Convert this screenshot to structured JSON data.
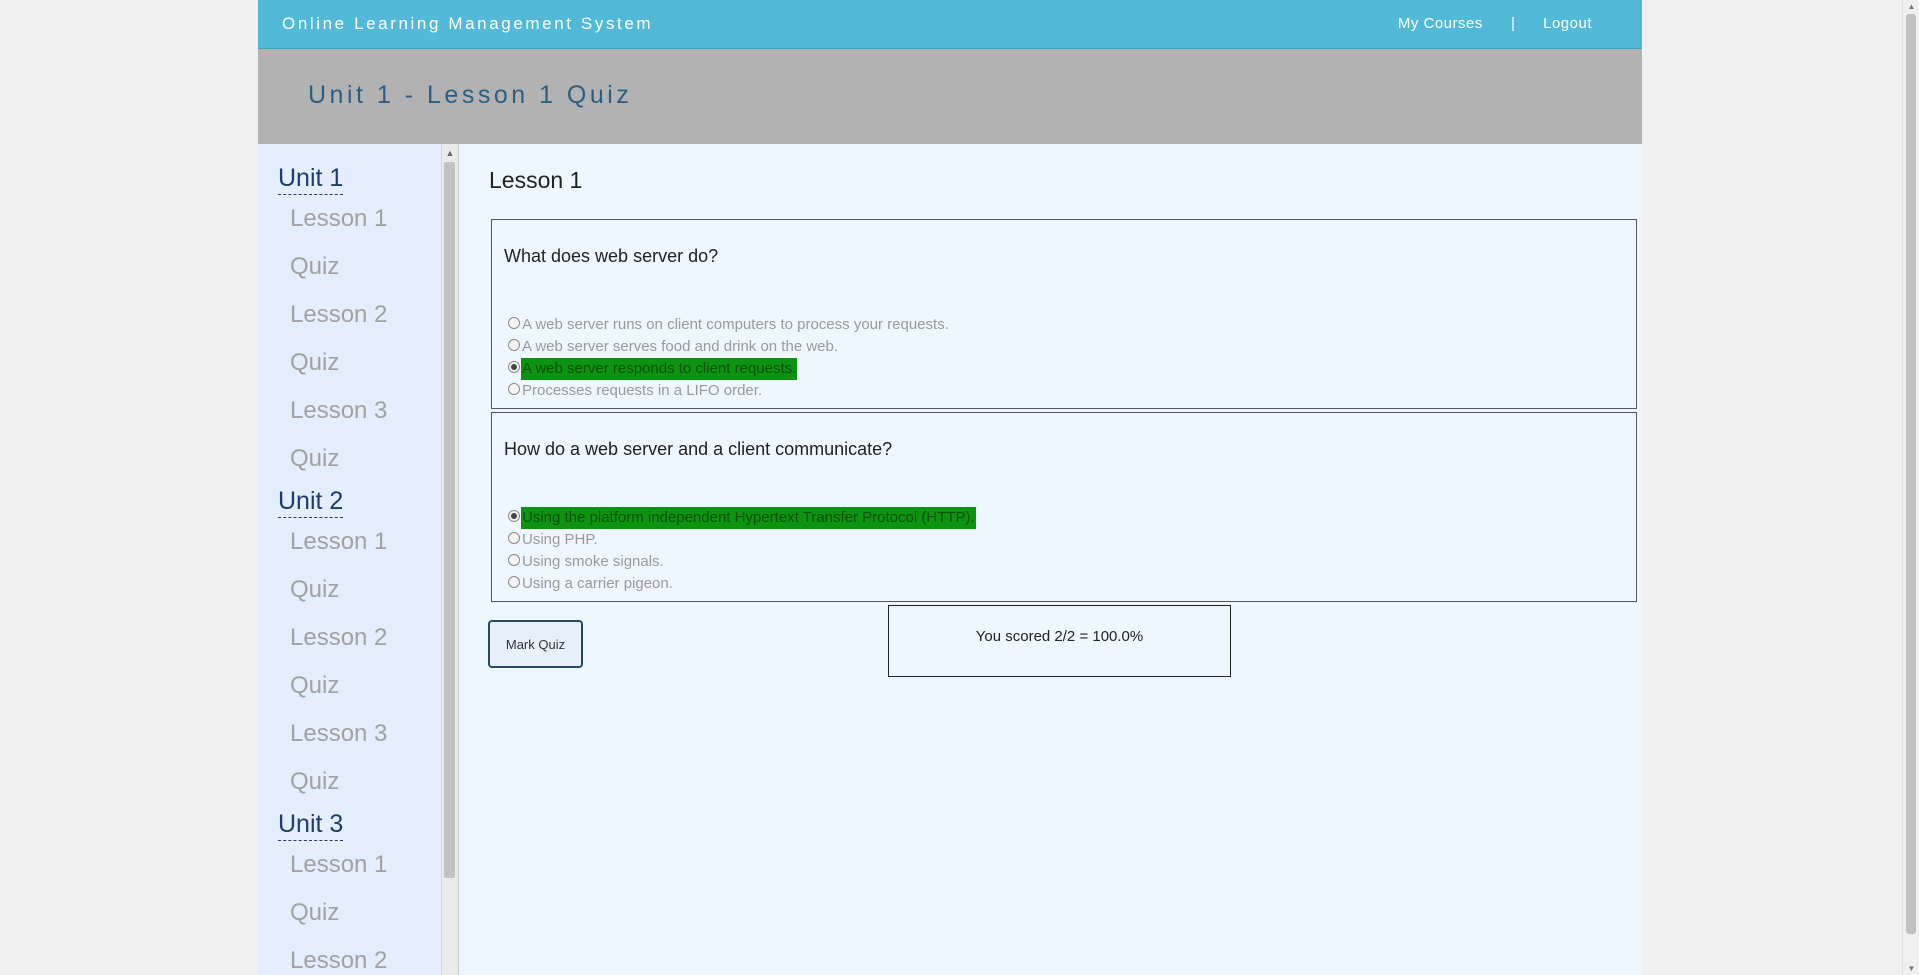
{
  "header": {
    "brand": "Online Learning Management System",
    "nav": [
      {
        "label": "My Courses"
      },
      {
        "label": "|"
      },
      {
        "label": "Logout"
      }
    ]
  },
  "banner": {
    "title": "Unit 1 - Lesson 1 Quiz"
  },
  "sidebar": {
    "units": [
      {
        "label": "Unit 1",
        "items": [
          "Lesson 1",
          "Quiz",
          "Lesson 2",
          "Quiz",
          "Lesson 3",
          "Quiz"
        ]
      },
      {
        "label": "Unit 2",
        "items": [
          "Lesson 1",
          "Quiz",
          "Lesson 2",
          "Quiz",
          "Lesson 3",
          "Quiz"
        ]
      },
      {
        "label": "Unit 3",
        "items": [
          "Lesson 1",
          "Quiz",
          "Lesson 2"
        ]
      }
    ]
  },
  "main": {
    "lesson_title": "Lesson 1",
    "questions": [
      {
        "text": "What does web server do?",
        "options": [
          {
            "label": "A web server runs on client computers to process your requests.",
            "checked": false,
            "correct": false
          },
          {
            "label": "A web server serves food and drink on the web.",
            "checked": false,
            "correct": false
          },
          {
            "label": "A web server responds to client requests.",
            "checked": true,
            "correct": true
          },
          {
            "label": "Processes requests in a LIFO order.",
            "checked": false,
            "correct": false
          }
        ]
      },
      {
        "text": "How do a web server and a client communicate?",
        "options": [
          {
            "label": "Using the platform independent Hypertext Transfer Protocol (HTTP).",
            "checked": true,
            "correct": true
          },
          {
            "label": "Using PHP.",
            "checked": false,
            "correct": false
          },
          {
            "label": "Using smoke signals.",
            "checked": false,
            "correct": false
          },
          {
            "label": "Using a carrier pigeon.",
            "checked": false,
            "correct": false
          }
        ]
      }
    ],
    "mark_button": "Mark Quiz",
    "score": "You scored 2/2 = 100.0%"
  },
  "colors": {
    "header_bg": "#52bad8",
    "banner_bg": "#b2b2b2",
    "correct_highlight": "#0c9410"
  }
}
